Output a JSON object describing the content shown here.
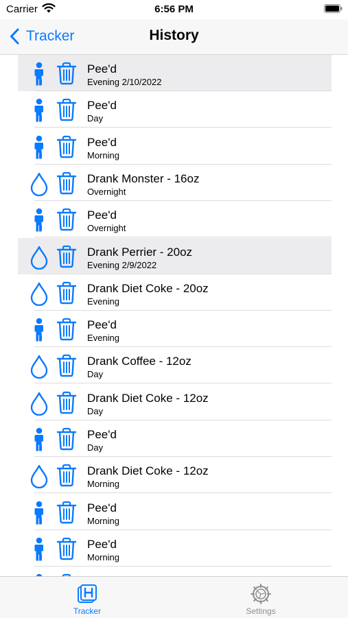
{
  "status": {
    "carrier": "Carrier",
    "time": "6:56 PM"
  },
  "nav": {
    "back_label": "Tracker",
    "title": "History"
  },
  "colors": {
    "accent": "#0a7aff",
    "inactive": "#8e8e93",
    "selected_row": "#ececee"
  },
  "rows": [
    {
      "type": "pee",
      "title": "Pee'd",
      "subtitle": "Evening 2/10/2022",
      "selected": true
    },
    {
      "type": "pee",
      "title": "Pee'd",
      "subtitle": "Day"
    },
    {
      "type": "pee",
      "title": "Pee'd",
      "subtitle": "Morning"
    },
    {
      "type": "drink",
      "title": "Drank Monster - 16oz",
      "subtitle": "Overnight"
    },
    {
      "type": "pee",
      "title": "Pee'd",
      "subtitle": "Overnight"
    },
    {
      "type": "drink",
      "title": "Drank Perrier - 20oz",
      "subtitle": "Evening 2/9/2022",
      "selected": true
    },
    {
      "type": "drink",
      "title": "Drank Diet Coke - 20oz",
      "subtitle": "Evening"
    },
    {
      "type": "pee",
      "title": "Pee'd",
      "subtitle": "Evening"
    },
    {
      "type": "drink",
      "title": "Drank Coffee - 12oz",
      "subtitle": "Day"
    },
    {
      "type": "drink",
      "title": "Drank Diet Coke - 12oz",
      "subtitle": "Day"
    },
    {
      "type": "pee",
      "title": "Pee'd",
      "subtitle": "Day"
    },
    {
      "type": "drink",
      "title": "Drank Diet Coke - 12oz",
      "subtitle": "Morning"
    },
    {
      "type": "pee",
      "title": "Pee'd",
      "subtitle": "Morning"
    },
    {
      "type": "pee",
      "title": "Pee'd",
      "subtitle": "Morning"
    },
    {
      "type": "pee",
      "title": "",
      "subtitle": ""
    }
  ],
  "tabs": [
    {
      "label": "Tracker",
      "icon": "tracker-h-icon",
      "active": true
    },
    {
      "label": "Settings",
      "icon": "gear-icon",
      "active": false
    }
  ]
}
